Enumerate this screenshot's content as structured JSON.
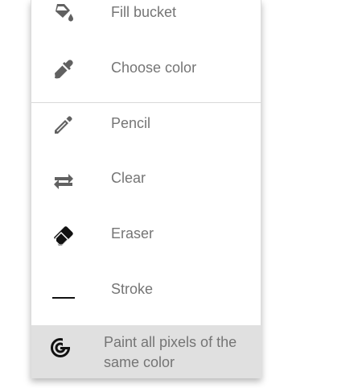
{
  "menu": {
    "items": [
      {
        "label": "Fill bucket",
        "icon": "fill-bucket-icon"
      },
      {
        "label": "Choose color",
        "icon": "eyedropper-icon"
      },
      {
        "label": "Pencil",
        "icon": "pencil-icon"
      },
      {
        "label": "Clear",
        "icon": "swap-arrows-icon"
      },
      {
        "label": "Eraser",
        "icon": "eraser-icon"
      },
      {
        "label": "Stroke",
        "icon": "stroke-line-icon"
      },
      {
        "label": "Paint all pixels of the same color",
        "icon": "paint-all-icon",
        "selected": true
      }
    ]
  },
  "colors": {
    "icon": "#616161",
    "text": "#757575",
    "selected_background": "#e0e0e0"
  }
}
